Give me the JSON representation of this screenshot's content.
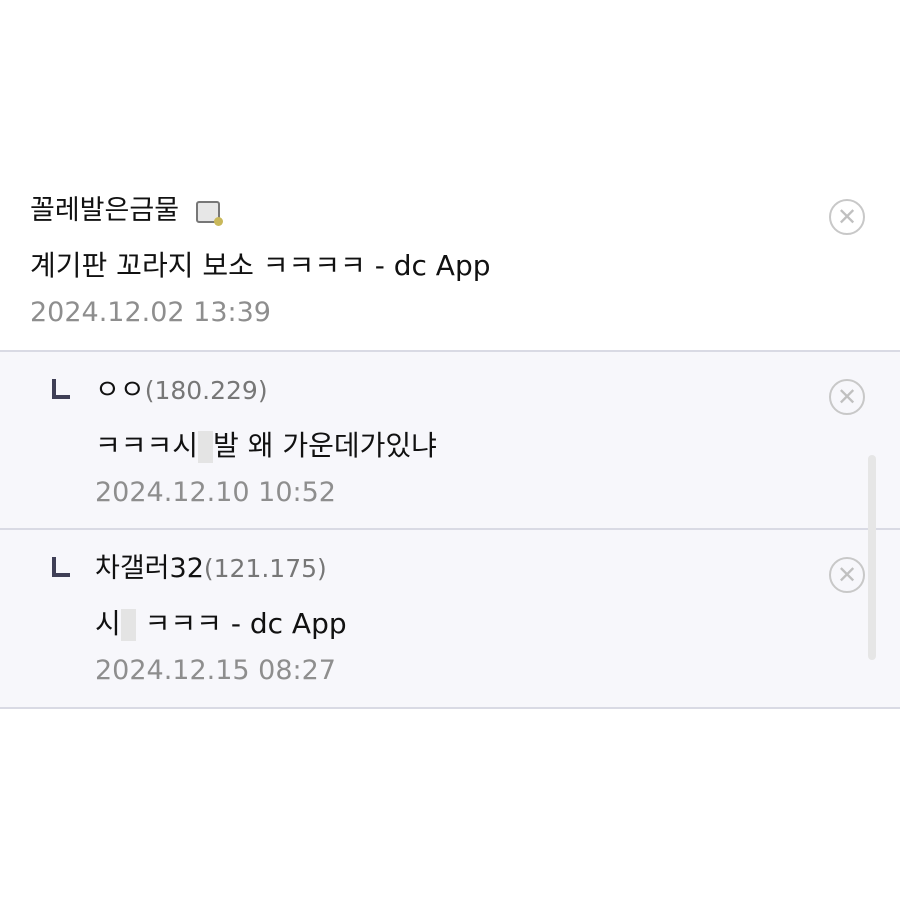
{
  "comments": [
    {
      "author": "꼴레발은금물",
      "ip": "",
      "content": "계기판 꼬라지 보소 ㅋㅋㅋㅋ - dc App",
      "timestamp": "2024.12.02 13:39",
      "has_mobile_icon": true,
      "is_reply": false
    },
    {
      "author": "ㅇㅇ",
      "ip": "(180.229)",
      "content_before": "ㅋㅋㅋ시",
      "content_after": "발 왜 가운데가있냐",
      "timestamp": "2024.12.10 10:52",
      "is_reply": true
    },
    {
      "author": "차갤러32",
      "ip": "(121.175)",
      "content_before": "시",
      "content_after": " ㅋㅋㅋ - dc App",
      "timestamp": "2024.12.15 08:27",
      "is_reply": true
    }
  ],
  "icons": {
    "delete": "close-circle-icon",
    "reply": "reply-arrow-icon",
    "mobile": "mobile-post-icon"
  },
  "colors": {
    "reply_bg": "#f7f7fb",
    "divider": "#d9dae4",
    "timestamp": "#8e8e8e",
    "reply_arrow": "#3f3f56"
  }
}
